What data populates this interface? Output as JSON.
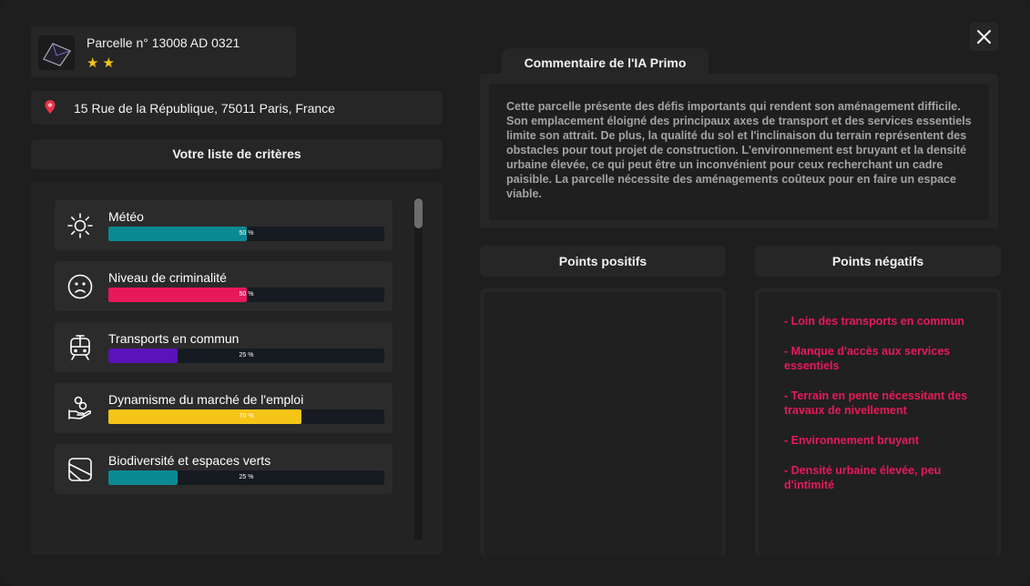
{
  "parcel": {
    "title": "Parcelle n° 13008 AD 0321",
    "stars_text": "★★",
    "rating": 2,
    "icon": "parcel-map-icon"
  },
  "address": {
    "text": "15 Rue de la République, 75011 Paris, France",
    "icon": "map-pin-icon"
  },
  "criteria": {
    "title": "Votre liste de critères",
    "items": [
      {
        "label": "Météo",
        "percent": 50,
        "percent_text": "50 %",
        "color": "#0b8a93",
        "icon": "sun-icon"
      },
      {
        "label": "Niveau de criminalité",
        "percent": 50,
        "percent_text": "50 %",
        "color": "#e8195a",
        "icon": "sad-face-icon"
      },
      {
        "label": "Transports en commun",
        "percent": 25,
        "percent_text": "25 %",
        "color": "#5b12b8",
        "icon": "train-icon"
      },
      {
        "label": "Dynamisme du marché de l'emploi",
        "percent": 70,
        "percent_text": "70 %",
        "color": "#f5c518",
        "icon": "hand-coins-icon"
      },
      {
        "label": "Biodiversité et espaces verts",
        "percent": 25,
        "percent_text": "25 %",
        "color": "#0b8a93",
        "icon": "map-square-icon"
      }
    ]
  },
  "comment": {
    "title": "Commentaire de l'IA Primo",
    "text": "Cette parcelle présente des défis importants qui rendent son aménagement difficile. Son emplacement éloigné des principaux axes de transport et des services essentiels limite son attrait. De plus, la qualité du sol et l'inclinaison du terrain représentent des obstacles pour tout projet de construction. L'environnement est bruyant et la densité urbaine élevée, ce qui peut être un inconvénient pour ceux recherchant un cadre paisible. La parcelle nécessite des aménagements coûteux pour en faire un espace viable."
  },
  "positives": {
    "title": "Points positifs",
    "items": []
  },
  "negatives": {
    "title": "Points négatifs",
    "items": [
      "- Loin des transports en commun",
      "- Manque d'accès aux services essentiels",
      "- Terrain en pente nécessitant des travaux de nivellement",
      "- Environnement bruyant",
      "- Densité urbaine élevée, peu d'intimité"
    ],
    "color": "#e8195a"
  },
  "close": {
    "icon": "close-icon"
  }
}
